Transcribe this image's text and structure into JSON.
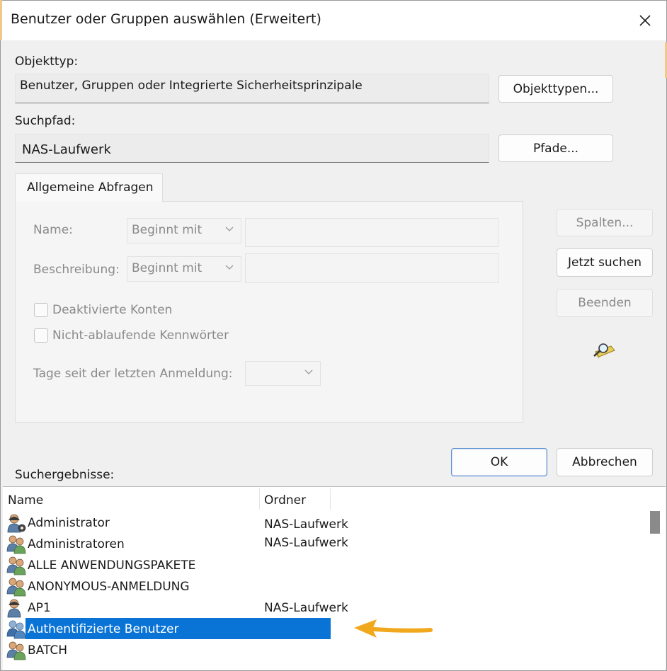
{
  "dialog": {
    "title": "Benutzer oder Gruppen auswählen (Erweitert)"
  },
  "object_type": {
    "label": "Objekttyp:",
    "value": "Benutzer, Gruppen oder Integrierte Sicherheitsprinzipale",
    "button": "Objekttypen..."
  },
  "search_path": {
    "label": "Suchpfad:",
    "value": "NAS-Laufwerk",
    "button": "Pfade..."
  },
  "queries": {
    "tab_label": "Allgemeine Abfragen",
    "name_label": "Name:",
    "name_mode": "Beginnt mit",
    "description_label": "Beschreibung:",
    "description_mode": "Beginnt mit",
    "disabled_accounts": "Deaktivierte Konten",
    "non_expiring_passwords": "Nicht-ablaufende Kennwörter",
    "days_since_logon_label": "Tage seit der letzten Anmeldung:"
  },
  "side_buttons": {
    "columns": "Spalten...",
    "search_now": "Jetzt suchen",
    "stop": "Beenden"
  },
  "dialog_buttons": {
    "ok": "OK",
    "cancel": "Abbrechen"
  },
  "results": {
    "label": "Suchergebnisse:",
    "columns": [
      "Name",
      "Ordner"
    ],
    "rows": [
      {
        "name": "Administrator",
        "folder": "NAS-Laufwerk",
        "icon": "user-admin-icon"
      },
      {
        "name": "Administratoren",
        "folder": "NAS-Laufwerk",
        "icon": "group-icon"
      },
      {
        "name": "ALLE ANWENDUNGSPAKETE",
        "folder": "",
        "icon": "group-icon"
      },
      {
        "name": "ANONYMOUS-ANMELDUNG",
        "folder": "",
        "icon": "group-icon"
      },
      {
        "name": "AP1",
        "folder": "NAS-Laufwerk",
        "icon": "user-icon"
      },
      {
        "name": "Authentifizierte Benutzer",
        "folder": "",
        "icon": "group-icon",
        "selected": true
      },
      {
        "name": "BATCH",
        "folder": "",
        "icon": "group-icon"
      }
    ]
  },
  "colors": {
    "selection": "#0a74d6",
    "annotation_arrow": "#f2a81d"
  }
}
